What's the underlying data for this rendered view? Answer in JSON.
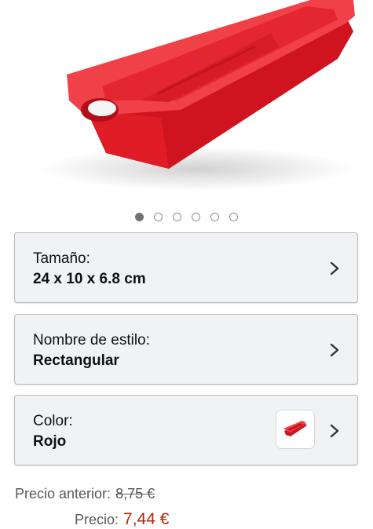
{
  "product_image": {
    "alt": "Molde rectangular de silicona rojo",
    "color": "#e8232f"
  },
  "carousel": {
    "total": 6,
    "active_index": 0
  },
  "options": [
    {
      "label": "Tamaño:",
      "value": "24 x 10 x 6.8 cm"
    },
    {
      "label": "Nombre de estilo:",
      "value": "Rectangular"
    },
    {
      "label": "Color:",
      "value": "Rojo",
      "swatch_color": "#e8232f"
    }
  ],
  "price": {
    "previous_label": "Precio anterior:",
    "previous_value": "8,75 €",
    "current_label": "Precio:",
    "current_value": "7,44 €",
    "current_color": "#b12704"
  },
  "icons": {
    "chevron": "chevron-right-icon"
  }
}
